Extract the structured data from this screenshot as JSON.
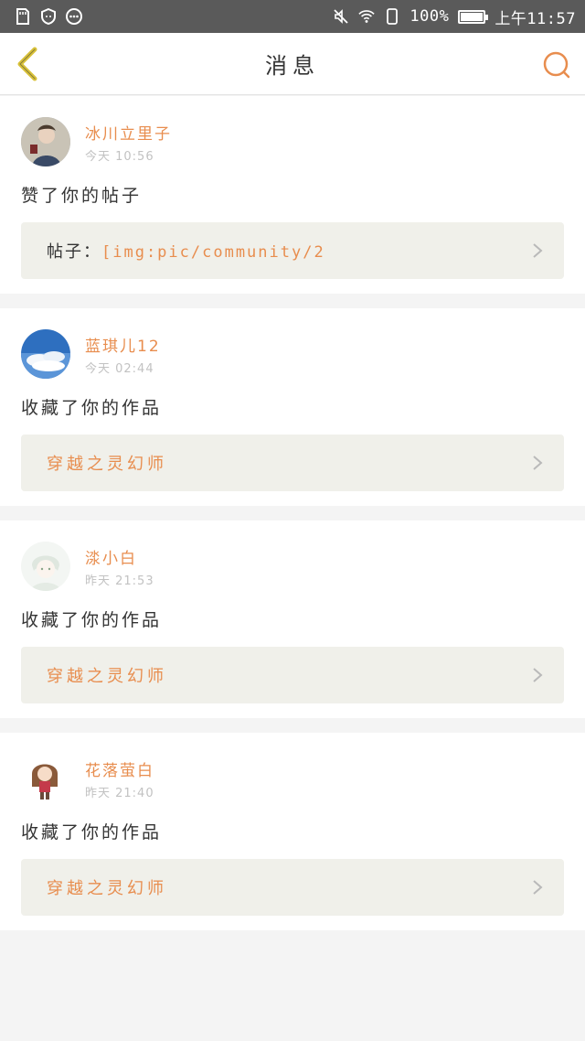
{
  "status_bar": {
    "battery_percent": "100%",
    "time": "上午11:57",
    "icons": [
      "sd-card-icon",
      "shield-icon",
      "more-dots-icon",
      "mute-icon",
      "wifi-icon",
      "sim-icon",
      "battery-icon"
    ]
  },
  "header": {
    "title": "消息",
    "back_icon": "chevron-left-icon",
    "search_icon": "search-icon"
  },
  "colors": {
    "accent": "#e88d4e",
    "back_arrow": "#d9c23a",
    "status_bar": "#5a5a5a"
  },
  "messages": [
    {
      "user": "冰川立里子",
      "time": "今天 10:56",
      "action": "赞了你的帖子",
      "ref_prefix": "帖子：",
      "ref_link": "[img:pic/community/2",
      "ref_title": ""
    },
    {
      "user": "蓝琪儿12",
      "time": "今天 02:44",
      "action": "收藏了你的作品",
      "ref_prefix": "",
      "ref_link": "",
      "ref_title": "穿越之灵幻师"
    },
    {
      "user": "渁小白",
      "time": "昨天 21:53",
      "action": "收藏了你的作品",
      "ref_prefix": "",
      "ref_link": "",
      "ref_title": "穿越之灵幻师"
    },
    {
      "user": "花落萤白",
      "time": "昨天 21:40",
      "action": "收藏了你的作品",
      "ref_prefix": "",
      "ref_link": "",
      "ref_title": "穿越之灵幻师"
    }
  ]
}
